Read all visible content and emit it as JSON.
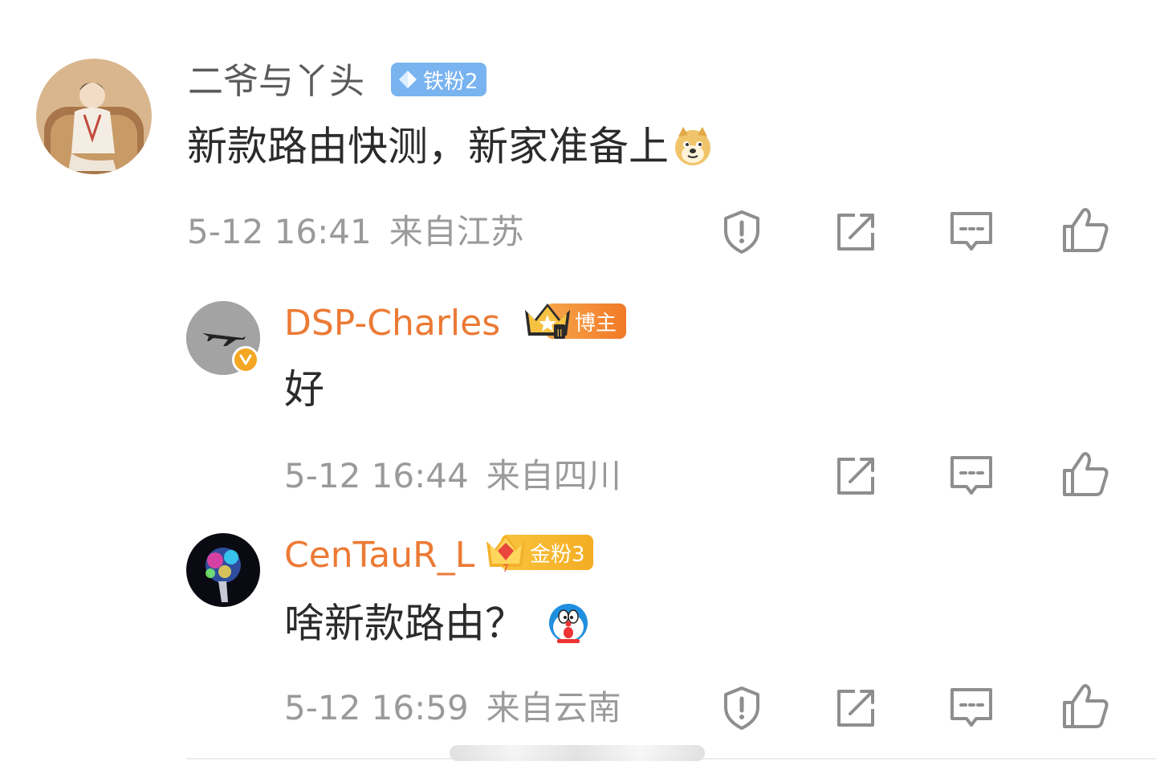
{
  "comment": {
    "username": "二爷与丫头",
    "badge_label": "铁粉2",
    "text": "新款路由快测，新家准备上",
    "emoji_icon": "doge-emoji-icon",
    "time": "5-12 16:41",
    "location": "来自江苏"
  },
  "replies": [
    {
      "username": "DSP-Charles",
      "badge_label": "博主",
      "verified": true,
      "text": "好",
      "time": "5-12 16:44",
      "location": "来自四川"
    },
    {
      "username": "CenTauR_L",
      "badge_label": "金粉3",
      "text": "啥新款路由？",
      "emoji_icon": "doraemon-emoji-icon",
      "time": "5-12 16:59",
      "location": "来自云南"
    }
  ],
  "icons": {
    "report": "report-icon",
    "share": "share-icon",
    "comment": "comment-icon",
    "like": "like-icon"
  },
  "colors": {
    "username_main": "#5a5a5a",
    "username_reply": "#ec7a35",
    "meta": "#9a9a9a",
    "icon": "#8e8e8e",
    "badge_tiefen": "#79b3f0",
    "badge_bozhu": "#f17a27",
    "badge_jinfen": "#f4ad24"
  }
}
